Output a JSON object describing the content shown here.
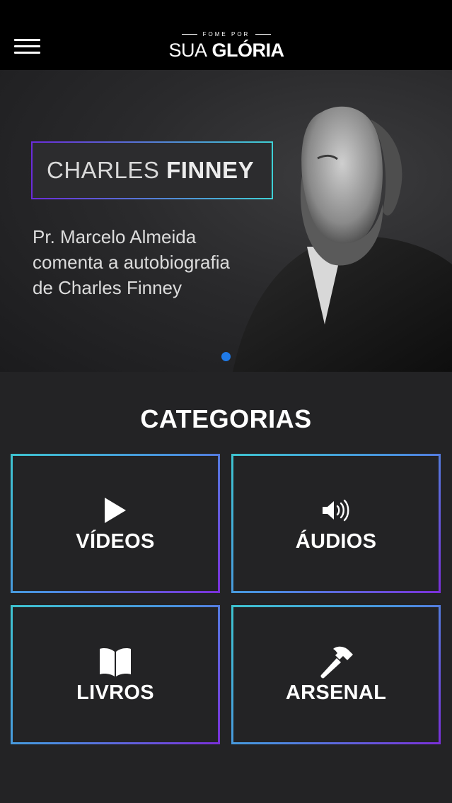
{
  "header": {
    "logo_top": "FOME POR",
    "logo_main_part1": "SUA",
    "logo_main_part2": "GLÓRIA"
  },
  "banner": {
    "title_light": "CHARLES",
    "title_bold": "FINNEY",
    "description_line1": "Pr. Marcelo Almeida",
    "description_line2": "comenta a autobiografia",
    "description_line3": "de Charles Finney",
    "slide_count": 1,
    "active_slide": 1,
    "dot_color": "#1f7ae8"
  },
  "categories": {
    "title": "CATEGORIAS",
    "items": [
      {
        "label": "VÍDEOS",
        "icon": "play-icon"
      },
      {
        "label": "ÁUDIOS",
        "icon": "speaker-icon"
      },
      {
        "label": "LIVROS",
        "icon": "book-icon"
      },
      {
        "label": "ARSENAL",
        "icon": "hammer-icon"
      }
    ]
  },
  "colors": {
    "background": "#232325",
    "topbar": "#000000",
    "gradient_start": "#3ec4d0",
    "gradient_end": "#7a2fd9"
  }
}
